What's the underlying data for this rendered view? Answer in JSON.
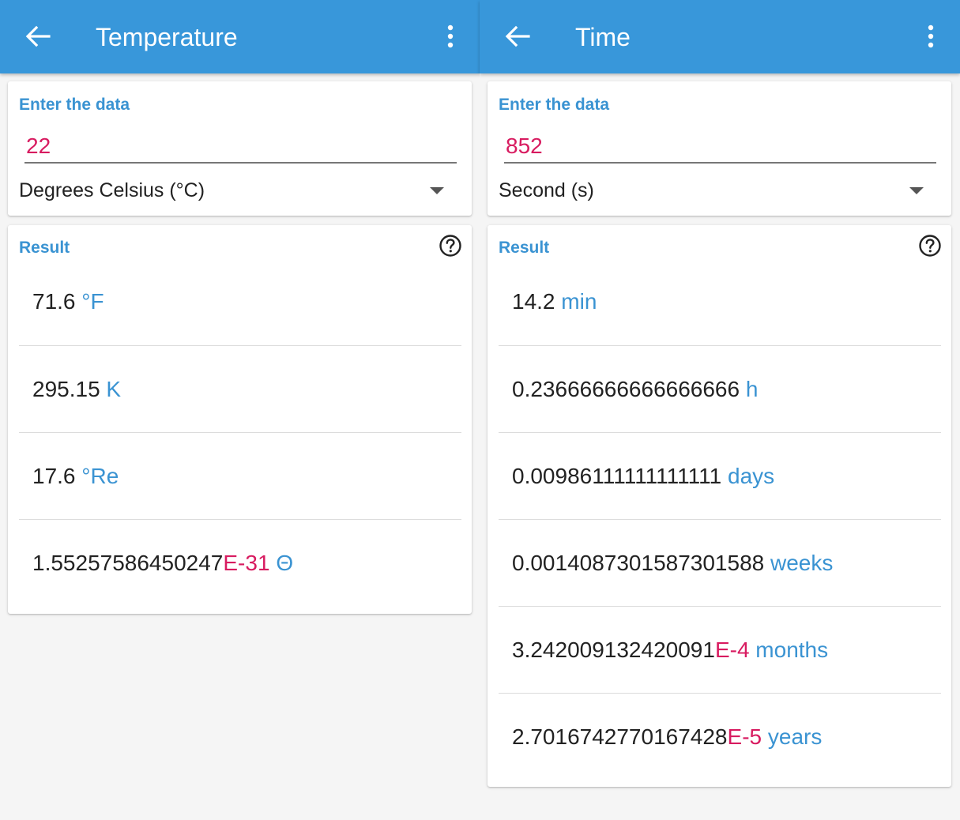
{
  "colors": {
    "appbar": "#3897da",
    "accent_blue": "#3a93d2",
    "accent_pink": "#d81b60"
  },
  "icons": {
    "back": "arrow-left",
    "menu": "more-vertical",
    "help": "question-circle",
    "dropdown": "caret-down"
  },
  "screens": [
    {
      "title": "Temperature",
      "input_label": "Enter the data",
      "input_value": "22",
      "unit": "Degrees Celsius (°C)",
      "result_label": "Result",
      "results": [
        {
          "value": "71.6",
          "exponent": "",
          "unit": "°F"
        },
        {
          "value": "295.15",
          "exponent": "",
          "unit": "K"
        },
        {
          "value": "17.6",
          "exponent": "",
          "unit": "°Re"
        },
        {
          "value": "1.55257586450247",
          "exponent": "E-31",
          "unit": "Θ"
        }
      ]
    },
    {
      "title": "Time",
      "input_label": "Enter the data",
      "input_value": "852",
      "unit": "Second (s)",
      "result_label": "Result",
      "results": [
        {
          "value": "14.2",
          "exponent": "",
          "unit": "min"
        },
        {
          "value": "0.23666666666666666",
          "exponent": "",
          "unit": "h"
        },
        {
          "value": "0.00986111111111111",
          "exponent": "",
          "unit": "days"
        },
        {
          "value": "0.0014087301587301588",
          "exponent": "",
          "unit": "weeks"
        },
        {
          "value": "3.242009132420091",
          "exponent": "E-4",
          "unit": "months"
        },
        {
          "value": "2.7016742770167428",
          "exponent": "E-5",
          "unit": "years"
        }
      ]
    }
  ]
}
